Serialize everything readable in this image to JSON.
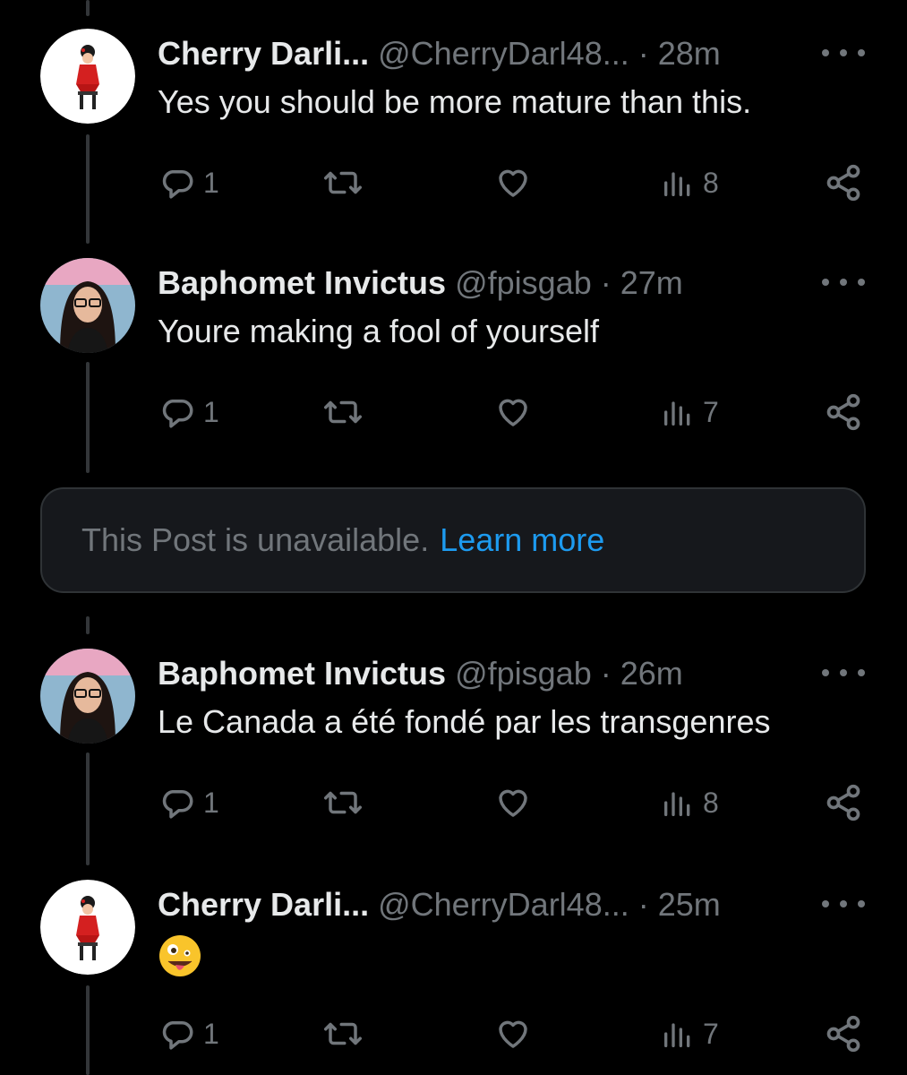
{
  "tweets": [
    {
      "name": "Cherry Darli...",
      "handle": "@CherryDarl48...",
      "time": "· 28m",
      "text": "Yes you should be more mature than this.",
      "replies": "1",
      "views": "8"
    },
    {
      "name": "Baphomet Invictus",
      "handle": "@fpisgab",
      "time": "· 27m",
      "text": "Youre making a fool of yourself",
      "replies": "1",
      "views": "7"
    },
    {
      "name": "Baphomet Invictus",
      "handle": "@fpisgab",
      "time": "· 26m",
      "text": "Le Canada a été fondé par les transgenres",
      "replies": "1",
      "views": "8"
    },
    {
      "name": "Cherry Darli...",
      "handle": "@CherryDarl48...",
      "time": "· 25m",
      "text": "",
      "emoji": "zany-face-emoji",
      "replies": "1",
      "views": "7"
    }
  ],
  "unavailable": {
    "message": "This Post is unavailable.",
    "link": "Learn more"
  },
  "icons": [
    "reply-icon",
    "repost-icon",
    "like-icon",
    "views-icon",
    "share-icon",
    "more-icon"
  ],
  "colors": {
    "background": "#000000",
    "primary_text": "#e7e9ea",
    "secondary_text": "#71767b",
    "link": "#1d9bf0",
    "thread_line": "#333639"
  }
}
